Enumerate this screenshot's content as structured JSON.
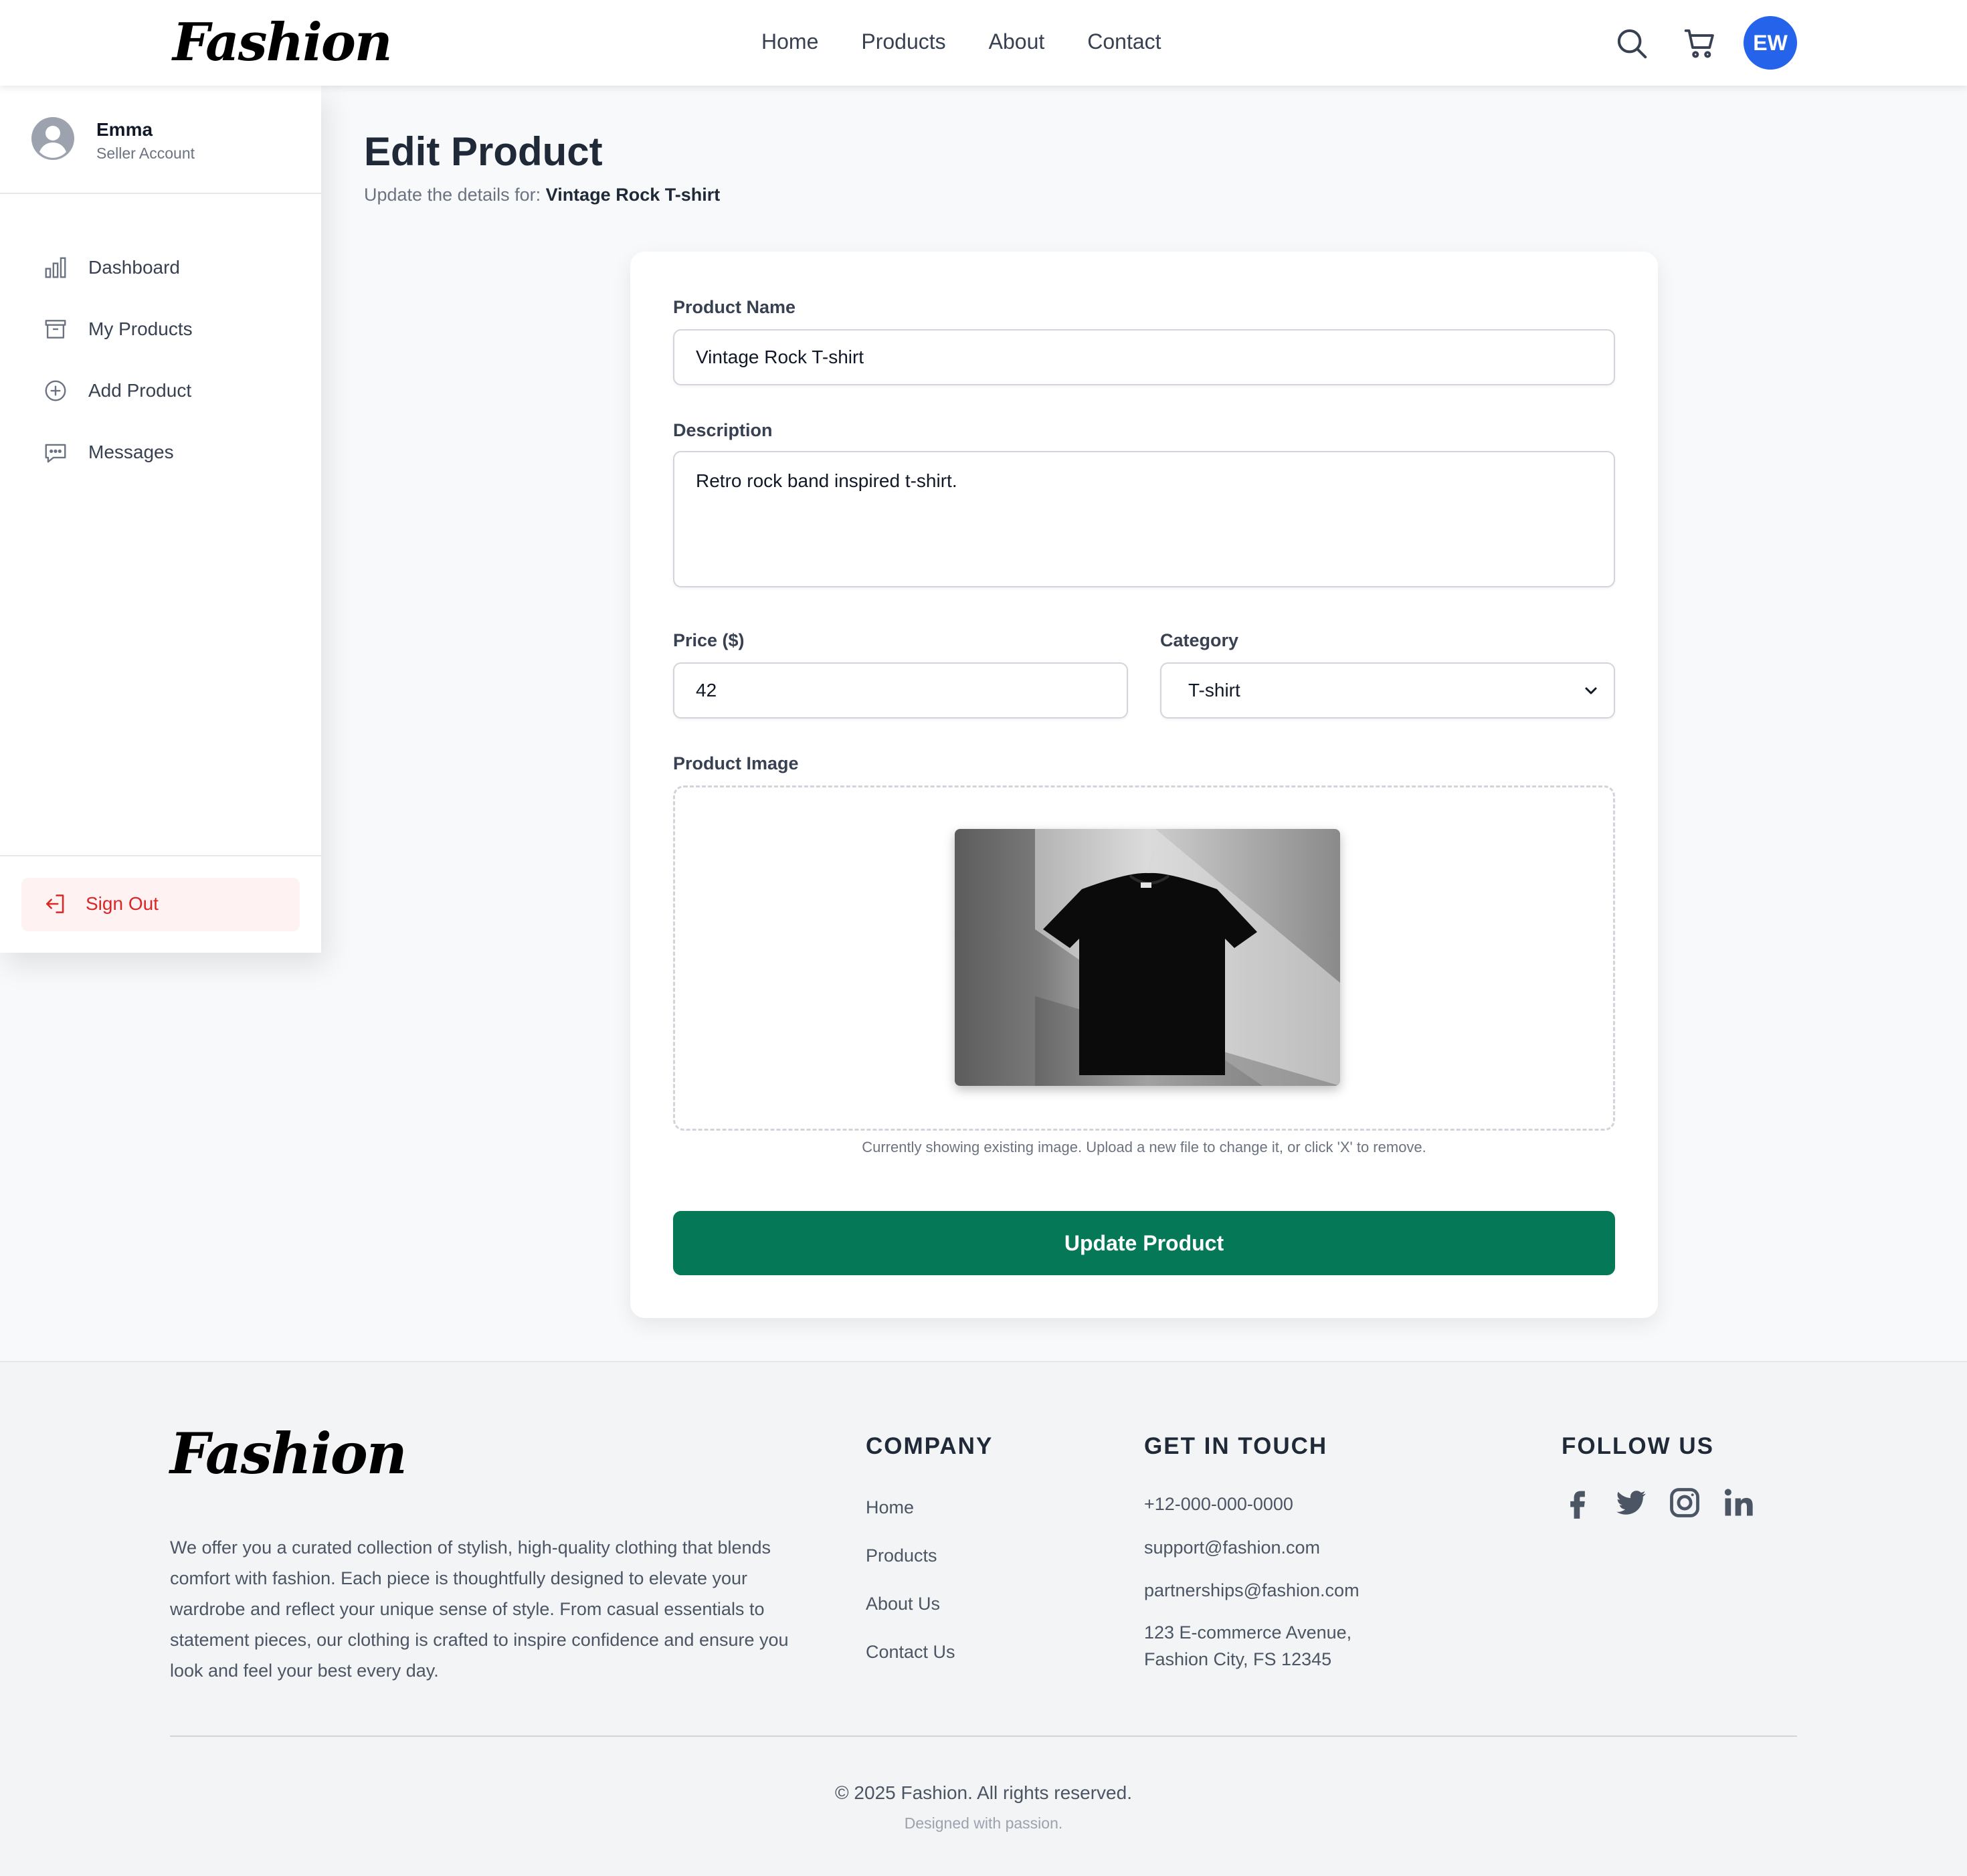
{
  "brand": {
    "name": "Fashion"
  },
  "nav": {
    "links": [
      "Home",
      "Products",
      "About",
      "Contact"
    ],
    "icons": [
      "search-icon",
      "cart-icon"
    ],
    "user_initials": "EW",
    "avatar_color": "#2563eb"
  },
  "sidebar": {
    "user_name": "Emma",
    "user_role": "Seller Account",
    "items": [
      {
        "label": "Dashboard",
        "icon": "bar-chart-icon"
      },
      {
        "label": "My Products",
        "icon": "archive-box-icon"
      },
      {
        "label": "Add Product",
        "icon": "plus-circle-icon"
      },
      {
        "label": "Messages",
        "icon": "chat-bubble-icon"
      }
    ],
    "sign_out": "Sign Out",
    "sign_out_color": "#dc2626"
  },
  "page": {
    "title": "Edit Product",
    "subtitle_prefix": "Update the details for: ",
    "subtitle_product": "Vintage Rock T-shirt"
  },
  "form": {
    "name_label": "Product Name",
    "name_value": "Vintage Rock T-shirt",
    "description_label": "Description",
    "description_value": "Retro rock band inspired t-shirt.",
    "price_label": "Price ($)",
    "price_value": "42",
    "category_label": "Category",
    "category_value": "T-shirt",
    "image_label": "Product Image",
    "image_note": "Currently showing existing image. Upload a new file to change it, or click 'X' to remove.",
    "submit_label": "Update Product",
    "submit_color": "#047857"
  },
  "footer": {
    "about": "We offer you a curated collection of stylish, high-quality clothing that blends comfort with fashion. Each piece is thoughtfully designed to elevate your wardrobe and reflect your unique sense of style. From casual essentials to statement pieces, our clothing is crafted to inspire confidence and ensure you look and feel your best every day.",
    "company_heading": "COMPANY",
    "company_links": [
      "Home",
      "Products",
      "About Us",
      "Contact Us"
    ],
    "contact_heading": "GET IN TOUCH",
    "phone": "+12-000-000-0000",
    "support_email": "support@fashion.com",
    "partner_email": "partnerships@fashion.com",
    "address_line1": "123 E-commerce Avenue,",
    "address_line2": "Fashion City, FS 12345",
    "follow_heading": "FOLLOW US",
    "socials": [
      "facebook-icon",
      "twitter-icon",
      "instagram-icon",
      "linkedin-icon"
    ],
    "copyright": "© 2025 Fashion. All rights reserved.",
    "tagline": "Designed with passion."
  }
}
